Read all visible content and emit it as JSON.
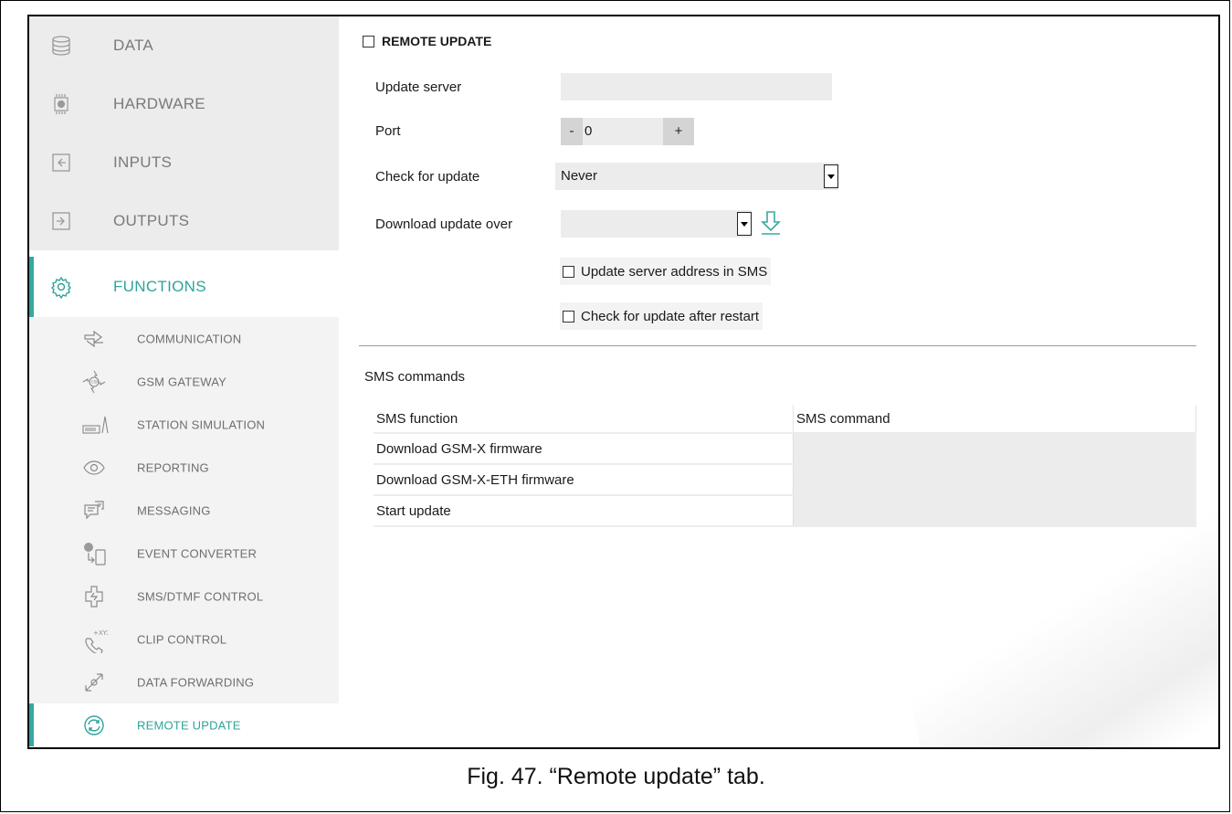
{
  "sidebar": {
    "main_items": [
      {
        "label": "DATA",
        "icon": "database-icon"
      },
      {
        "label": "HARDWARE",
        "icon": "chip-icon"
      },
      {
        "label": "INPUTS",
        "icon": "input-icon"
      },
      {
        "label": "OUTPUTS",
        "icon": "output-icon"
      },
      {
        "label": "FUNCTIONS",
        "icon": "gear-icon"
      }
    ],
    "sub_items": [
      {
        "label": "COMMUNICATION",
        "icon": "communication-icon"
      },
      {
        "label": "GSM GATEWAY",
        "icon": "gsm-gateway-icon"
      },
      {
        "label": "STATION SIMULATION",
        "icon": "station-simulation-icon"
      },
      {
        "label": "REPORTING",
        "icon": "eye-icon"
      },
      {
        "label": "MESSAGING",
        "icon": "message-icon"
      },
      {
        "label": "EVENT CONVERTER",
        "icon": "event-converter-icon"
      },
      {
        "label": "SMS/DTMF CONTROL",
        "icon": "sms-dtmf-icon"
      },
      {
        "label": "CLIP CONTROL",
        "icon": "clip-control-icon"
      },
      {
        "label": "DATA FORWARDING",
        "icon": "data-forwarding-icon"
      },
      {
        "label": "REMOTE UPDATE",
        "icon": "refresh-icon"
      }
    ],
    "accent_color": "#37a89f"
  },
  "remote_update": {
    "title": "REMOTE UPDATE",
    "update_server_label": "Update server",
    "update_server_value": "",
    "port_label": "Port",
    "port_minus": "-",
    "port_value": "0",
    "port_plus": "+",
    "check_label": "Check for update",
    "check_value": "Never",
    "download_label": "Download update over",
    "download_value": "",
    "sms_address_label": "Update server address in SMS",
    "restart_check_label": "Check for update after restart"
  },
  "sms": {
    "title": "SMS commands",
    "col_function": "SMS function",
    "col_command": "SMS command",
    "rows": [
      {
        "function": "Download GSM-X firmware",
        "command": ""
      },
      {
        "function": "Download GSM-X-ETH firmware",
        "command": ""
      },
      {
        "function": "Start update",
        "command": ""
      }
    ]
  },
  "caption": "Fig. 47. “Remote update” tab."
}
